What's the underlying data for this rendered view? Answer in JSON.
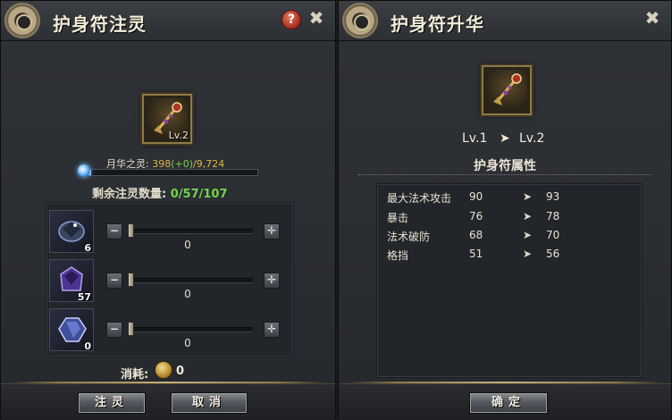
{
  "left_panel": {
    "title": "护身符注灵",
    "help_symbol": "?",
    "close_symbol": "✖",
    "amulet_level": "Lv.2",
    "moon_essence": {
      "label": "月华之灵:",
      "current": "398",
      "bonus": "(+0)",
      "max": "/9,724",
      "fill": 0.04
    },
    "remaining": {
      "label": "剩余注灵数量:",
      "value": "0/57/107"
    },
    "gems": [
      {
        "count": "6",
        "slider_value": "0",
        "icon": "dark-crystal-icon",
        "color": "#4a5c8a"
      },
      {
        "count": "57",
        "slider_value": "0",
        "icon": "purple-gem-icon",
        "color": "#5a3f9a"
      },
      {
        "count": "0",
        "slider_value": "0",
        "icon": "blue-gem-icon",
        "color": "#5b6fb8"
      }
    ],
    "minus_symbol": "−",
    "plus_symbol": "✛",
    "cost": {
      "label": "消耗:",
      "value": "0",
      "icon": "coin-icon"
    },
    "buttons": {
      "infuse": "注灵",
      "cancel": "取消"
    }
  },
  "right_panel": {
    "title": "护身符升华",
    "close_symbol": "✖",
    "level_from": "Lv.1",
    "level_to": "Lv.2",
    "arrow_symbol": "➤",
    "attributes_header": "护身符属性",
    "attributes": [
      {
        "name": "最大法术攻击",
        "old": "90",
        "new": "93"
      },
      {
        "name": "暴击",
        "old": "76",
        "new": "78"
      },
      {
        "name": "法术破防",
        "old": "68",
        "new": "70"
      },
      {
        "name": "格挡",
        "old": "51",
        "new": "56"
      }
    ],
    "confirm": "确定"
  },
  "colors": {
    "accent_gold": "#e0b743",
    "accent_green": "#76d34a",
    "panel_bg": "#2c2f34"
  }
}
